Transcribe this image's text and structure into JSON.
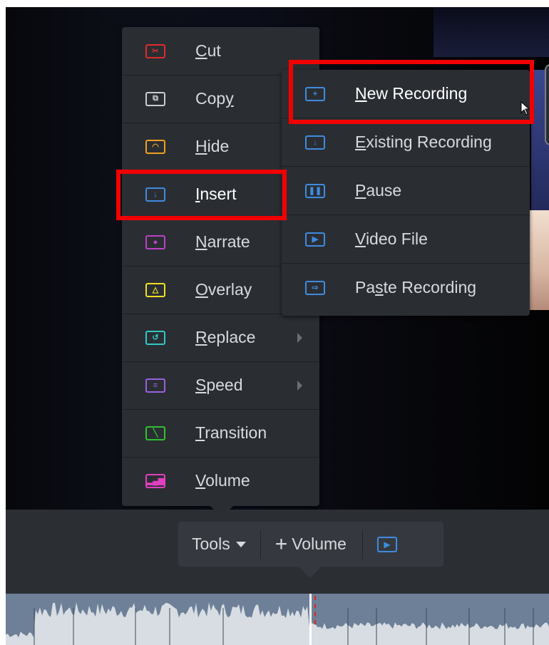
{
  "main_menu": {
    "items": [
      {
        "label": "Cut",
        "mnemonic": "C",
        "icon": "scissors-icon",
        "color": "#e02a2a"
      },
      {
        "label": "Copy",
        "mnemonic": "y",
        "icon": "copy-icon",
        "color": "#c9cdd2"
      },
      {
        "label": "Hide",
        "mnemonic": "H",
        "icon": "eye-closed-icon",
        "color": "#f0a020"
      },
      {
        "label": "Insert",
        "mnemonic": "I",
        "icon": "insert-icon",
        "color": "#3f8be0",
        "has_submenu": true,
        "open": true
      },
      {
        "label": "Narrate",
        "mnemonic": "N",
        "icon": "microphone-icon",
        "color": "#c040c8"
      },
      {
        "label": "Overlay",
        "mnemonic": "O",
        "icon": "overlay-triangle-icon",
        "color": "#f0e020"
      },
      {
        "label": "Replace",
        "mnemonic": "R",
        "icon": "replace-icon",
        "color": "#30c8c8",
        "has_submenu": true
      },
      {
        "label": "Speed",
        "mnemonic": "S",
        "icon": "speed-icon",
        "color": "#9a60e0",
        "has_submenu": true
      },
      {
        "label": "Transition",
        "mnemonic": "T",
        "icon": "transition-icon",
        "color": "#30c030"
      },
      {
        "label": "Volume",
        "mnemonic": "V",
        "icon": "volume-bars-icon",
        "color": "#e040c0"
      }
    ]
  },
  "insert_submenu": {
    "items": [
      {
        "label": "New Recording",
        "mnemonic": "N",
        "icon": "plus-box-icon"
      },
      {
        "label": "Existing Recording",
        "mnemonic": "E",
        "icon": "insert-down-icon"
      },
      {
        "label": "Pause",
        "mnemonic": "P",
        "icon": "pause-icon"
      },
      {
        "label": "Video File",
        "mnemonic": "V",
        "icon": "play-box-icon"
      },
      {
        "label": "Paste Recording",
        "mnemonic": "s",
        "icon": "paste-icon"
      }
    ]
  },
  "toolbar": {
    "tools_label": "Tools",
    "volume_label": "Volume",
    "play_icon": "play-box-icon"
  },
  "colors": {
    "highlight": "#f20000",
    "accent": "#3f8be0",
    "menu_bg": "#2a2e33"
  }
}
